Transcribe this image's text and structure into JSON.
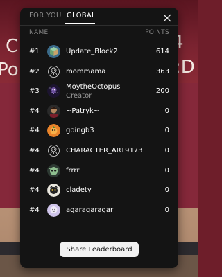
{
  "tabs": [
    {
      "label": "FOR YOU",
      "active": false
    },
    {
      "label": "GLOBAL",
      "active": true
    }
  ],
  "background_text": {
    "line1_left": "C",
    "line2_left": "Poi",
    "line1_right": "4",
    "line2_right": ":D"
  },
  "columns": {
    "name": "NAME",
    "points": "POINTS"
  },
  "rows": [
    {
      "rank": "#1",
      "name": "Update_Block2",
      "subtitle": "",
      "points": "614",
      "avatar": "cube-avatar-icon"
    },
    {
      "rank": "#2",
      "name": "mommama",
      "subtitle": "",
      "points": "363",
      "avatar": "octopus-avatar-icon"
    },
    {
      "rank": "#3",
      "name": "MoytheOctopus",
      "subtitle": "Creator",
      "points": "200",
      "avatar": "galaxy-octopus-avatar-icon"
    },
    {
      "rank": "#4",
      "name": "~Patryk~",
      "subtitle": "",
      "points": "0",
      "avatar": "character-avatar-icon"
    },
    {
      "rank": "#4",
      "name": "goingb3",
      "subtitle": "",
      "points": "0",
      "avatar": "orange-avatar-icon"
    },
    {
      "rank": "#4",
      "name": "CHARACTER_ART9173",
      "subtitle": "",
      "points": "0",
      "avatar": "octopus-avatar-icon"
    },
    {
      "rank": "#4",
      "name": "frrrr",
      "subtitle": "",
      "points": "0",
      "avatar": "alien-avatar-icon"
    },
    {
      "rank": "#4",
      "name": "cladety",
      "subtitle": "",
      "points": "0",
      "avatar": "cat-avatar-icon"
    },
    {
      "rank": "#4",
      "name": "agaragaragar",
      "subtitle": "",
      "points": "0",
      "avatar": "lavender-avatar-icon"
    }
  ],
  "share_button": "Share Leaderboard",
  "close_icon": "close-icon"
}
